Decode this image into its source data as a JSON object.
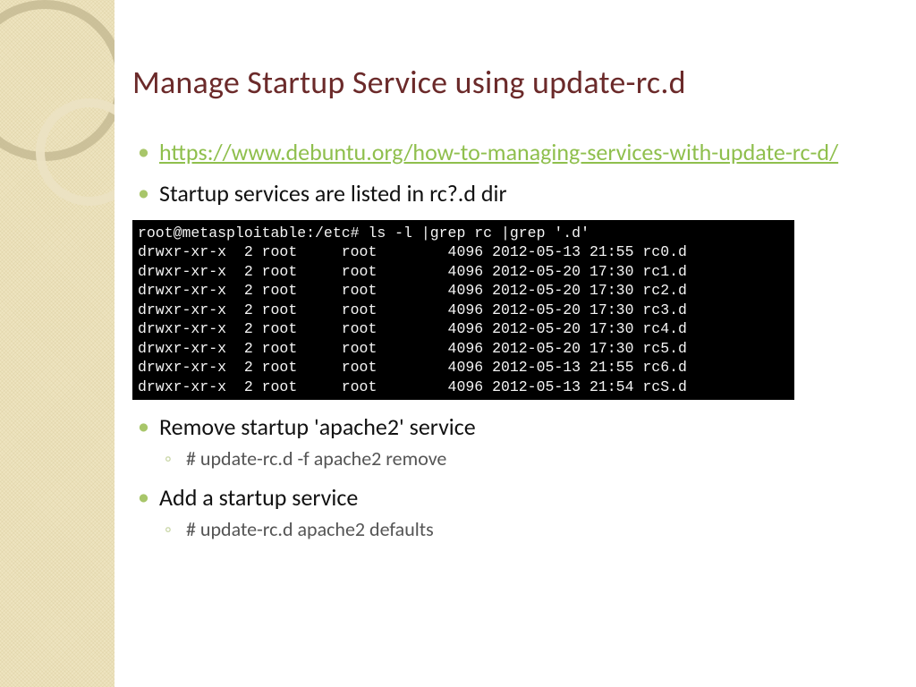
{
  "title": "Manage Startup Service using update-rc.d",
  "link_text": "https://www.debuntu.org/how-to-managing-services-with-update-rc-d/",
  "bullet2": "Startup services are listed in rc?.d dir",
  "bullet3": "Remove startup 'apache2' service",
  "bullet3_sub": "# update-rc.d -f apache2 remove",
  "bullet4": "Add a startup service",
  "bullet4_sub": "# update-rc.d apache2 defaults",
  "terminal": {
    "prompt": "root@metasploitable:/etc# ls -l |grep rc |grep '.d'",
    "rows": [
      {
        "perm": "drwxr-xr-x",
        "n": "2",
        "own": "root",
        "grp": "root",
        "size": "4096",
        "date": "2012-05-13 21:55",
        "name": "rc0.d"
      },
      {
        "perm": "drwxr-xr-x",
        "n": "2",
        "own": "root",
        "grp": "root",
        "size": "4096",
        "date": "2012-05-20 17:30",
        "name": "rc1.d"
      },
      {
        "perm": "drwxr-xr-x",
        "n": "2",
        "own": "root",
        "grp": "root",
        "size": "4096",
        "date": "2012-05-20 17:30",
        "name": "rc2.d"
      },
      {
        "perm": "drwxr-xr-x",
        "n": "2",
        "own": "root",
        "grp": "root",
        "size": "4096",
        "date": "2012-05-20 17:30",
        "name": "rc3.d"
      },
      {
        "perm": "drwxr-xr-x",
        "n": "2",
        "own": "root",
        "grp": "root",
        "size": "4096",
        "date": "2012-05-20 17:30",
        "name": "rc4.d"
      },
      {
        "perm": "drwxr-xr-x",
        "n": "2",
        "own": "root",
        "grp": "root",
        "size": "4096",
        "date": "2012-05-20 17:30",
        "name": "rc5.d"
      },
      {
        "perm": "drwxr-xr-x",
        "n": "2",
        "own": "root",
        "grp": "root",
        "size": "4096",
        "date": "2012-05-13 21:55",
        "name": "rc6.d"
      },
      {
        "perm": "drwxr-xr-x",
        "n": "2",
        "own": "root",
        "grp": "root",
        "size": "4096",
        "date": "2012-05-13 21:54",
        "name": "rcS.d"
      }
    ]
  }
}
